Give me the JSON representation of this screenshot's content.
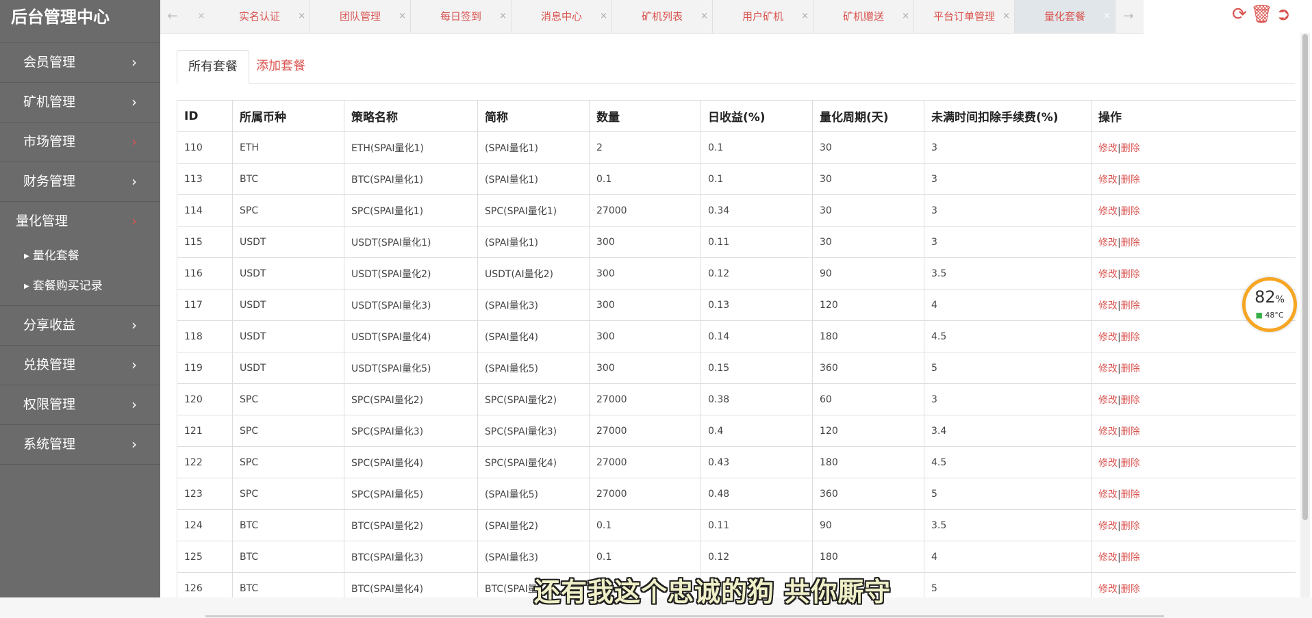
{
  "brand": "后台管理中心",
  "sidebar": {
    "items": [
      {
        "label": "会员管理"
      },
      {
        "label": "矿机管理"
      },
      {
        "label": "市场管理"
      },
      {
        "label": "财务管理"
      },
      {
        "label": "量化管理"
      },
      {
        "label": "分享收益"
      },
      {
        "label": "兑换管理"
      },
      {
        "label": "权限管理"
      },
      {
        "label": "系统管理"
      }
    ],
    "sub_items": [
      {
        "label": "量化套餐"
      },
      {
        "label": "套餐购买记录"
      }
    ]
  },
  "tabs": [
    {
      "label": "实名认证"
    },
    {
      "label": "团队管理"
    },
    {
      "label": "每日签到"
    },
    {
      "label": "消息中心"
    },
    {
      "label": "矿机列表"
    },
    {
      "label": "用户矿机"
    },
    {
      "label": "矿机赠送"
    },
    {
      "label": "平台订单管理"
    },
    {
      "label": "量化套餐"
    }
  ],
  "tab_close": "×",
  "inner_tabs": [
    {
      "label": "所有套餐"
    },
    {
      "label": "添加套餐"
    }
  ],
  "table": {
    "headers": [
      "ID",
      "所属币种",
      "策略名称",
      "简称",
      "数量",
      "日收益(%)",
      "量化周期(天)",
      "未满时间扣除手续费(%)",
      "操作"
    ],
    "rows": [
      [
        "110",
        "ETH",
        "ETH(SPAI量化1)",
        "(SPAI量化1)",
        "2",
        "0.1",
        "30",
        "3"
      ],
      [
        "113",
        "BTC",
        "BTC(SPAI量化1)",
        "(SPAI量化1)",
        "0.1",
        "0.1",
        "30",
        "3"
      ],
      [
        "114",
        "SPC",
        "SPC(SPAI量化1)",
        "SPC(SPAI量化1)",
        "27000",
        "0.34",
        "30",
        "3"
      ],
      [
        "115",
        "USDT",
        "USDT(SPAI量化1)",
        "(SPAI量化1)",
        "300",
        "0.11",
        "30",
        "3"
      ],
      [
        "116",
        "USDT",
        "USDT(SPAI量化2)",
        "USDT(AI量化2)",
        "300",
        "0.12",
        "90",
        "3.5"
      ],
      [
        "117",
        "USDT",
        "USDT(SPAI量化3)",
        "(SPAI量化3)",
        "300",
        "0.13",
        "120",
        "4"
      ],
      [
        "118",
        "USDT",
        "USDT(SPAI量化4)",
        "(SPAI量化4)",
        "300",
        "0.14",
        "180",
        "4.5"
      ],
      [
        "119",
        "USDT",
        "USDT(SPAI量化5)",
        "(SPAI量化5)",
        "300",
        "0.15",
        "360",
        "5"
      ],
      [
        "120",
        "SPC",
        "SPC(SPAI量化2)",
        "SPC(SPAI量化2)",
        "27000",
        "0.38",
        "60",
        "3"
      ],
      [
        "121",
        "SPC",
        "SPC(SPAI量化3)",
        "SPC(SPAI量化3)",
        "27000",
        "0.4",
        "120",
        "3.4"
      ],
      [
        "122",
        "SPC",
        "SPC(SPAI量化4)",
        "SPC(SPAI量化4)",
        "27000",
        "0.43",
        "180",
        "4.5"
      ],
      [
        "123",
        "SPC",
        "SPC(SPAI量化5)",
        "(SPAI量化5)",
        "27000",
        "0.48",
        "360",
        "5"
      ],
      [
        "124",
        "BTC",
        "BTC(SPAI量化2)",
        "(SPAI量化2)",
        "0.1",
        "0.11",
        "90",
        "3.5"
      ],
      [
        "125",
        "BTC",
        "BTC(SPAI量化3)",
        "(SPAI量化3)",
        "0.1",
        "0.12",
        "180",
        "4"
      ],
      [
        "126",
        "BTC",
        "BTC(SPAI量化4)",
        "BTC(SPAI量",
        "",
        "",
        "",
        "5"
      ]
    ],
    "edit_label": "修改",
    "separator": "|",
    "delete_label": "删除"
  },
  "battery": {
    "percent": "82",
    "unit": "%",
    "temp": "48°C"
  },
  "subtitle": "还有我这个忠诚的狗 共你厮守",
  "colors": {
    "accent": "#d9534f",
    "sidebar": "#6b6b6b",
    "battery_ring": "#f6a623"
  }
}
